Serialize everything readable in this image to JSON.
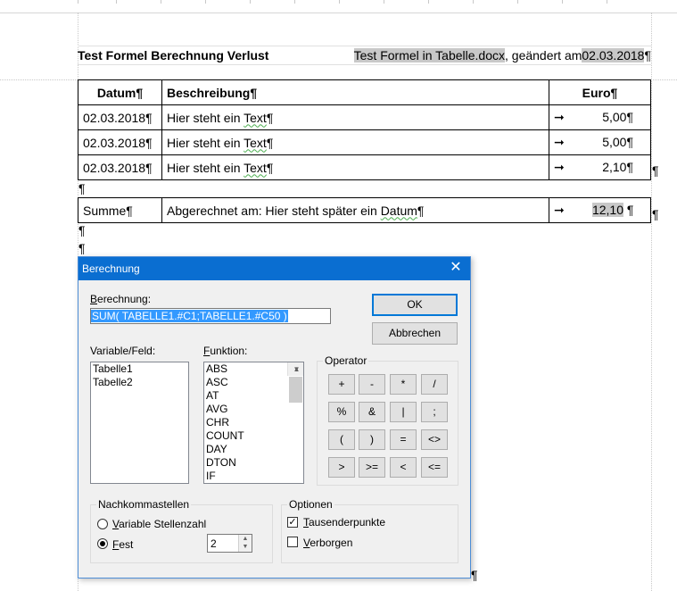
{
  "document": {
    "pilcrow": "¶",
    "header": {
      "title": "Test Formel Berechnung Verlust",
      "filename": "Test Formel in Tabelle.docx",
      "changed_text": ", geändert am",
      "changed_date": "02.03.2018"
    },
    "table": {
      "headers": [
        "Datum¶",
        "Beschreibung¶",
        "Euro¶"
      ],
      "rows": [
        {
          "date": "02.03.2018¶",
          "desc": "Hier steht ein ",
          "desc_word": "Text",
          "arrow": "➞",
          "euro": "5,00¶"
        },
        {
          "date": "02.03.2018¶",
          "desc": "Hier steht ein ",
          "desc_word": "Text",
          "arrow": "➞",
          "euro": "5,00¶"
        },
        {
          "date": "02.03.2018¶",
          "desc": "Hier steht ein ",
          "desc_word": "Text",
          "arrow": "➞",
          "euro": "2,10¶"
        }
      ]
    },
    "sum_row": {
      "label": "Summe¶",
      "desc": "Abgerechnet am: Hier steht später ein ",
      "desc_word": "Datum",
      "arrow": "➞",
      "value": "12,10",
      "after": " ¶"
    }
  },
  "dialog": {
    "title": "Berechnung",
    "close_glyph": "✕",
    "formula_label": "Berechnung:",
    "formula_label_access": "B",
    "formula_label_rest": "erechnung:",
    "formula_value": "SUM( TABELLE1.#C1;TABELLE1.#C50 )",
    "ok_label": "OK",
    "cancel_label": "Abbrechen",
    "variables_label": "Variable/Feld:",
    "variables": [
      "Tabelle1",
      "Tabelle2"
    ],
    "functions_label": "Funktion:",
    "functions_label_access": "F",
    "functions_label_rest": "unktion:",
    "functions": [
      "ABS",
      "ASC",
      "AT",
      "AVG",
      "CHR",
      "COUNT",
      "DAY",
      "DTON",
      "IF"
    ],
    "operator_label": "Operator",
    "operators": [
      [
        "+",
        "-",
        "*",
        "/"
      ],
      [
        "%",
        "&",
        "|",
        ";"
      ],
      [
        "(",
        ")",
        "=",
        "<>"
      ],
      [
        ">",
        ">=",
        "<",
        "<="
      ]
    ],
    "decimals_group": "Nachkommastellen",
    "radio_variable_access": "V",
    "radio_variable_rest": "ariable Stellenzahl",
    "radio_fixed_access": "F",
    "radio_fixed_rest": "est",
    "fixed_value": "2",
    "options_group": "Optionen",
    "check_thousands_access": "T",
    "check_thousands_rest": "ausenderpunkte",
    "check_thousands_mark": "✓",
    "check_hidden_access": "V",
    "check_hidden_rest": "erborgen"
  }
}
